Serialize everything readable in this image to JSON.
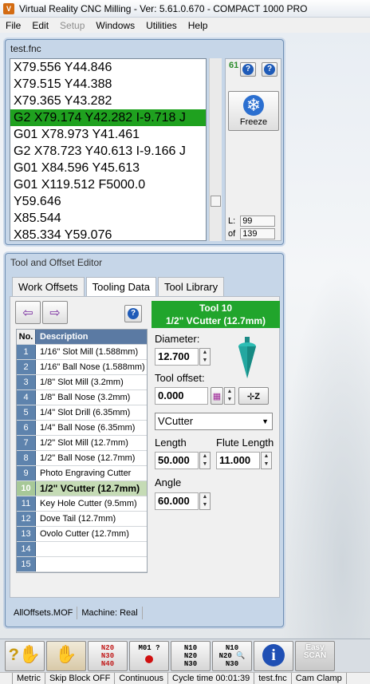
{
  "title_bar": {
    "title": "Virtual Reality CNC Milling  -  Ver: 5.61.0.670  -  COMPACT 1000 PRO"
  },
  "menu": {
    "items": [
      "File",
      "Edit",
      "Setup",
      "Windows",
      "Utilities",
      "Help"
    ]
  },
  "editor": {
    "title": "test.fnc",
    "lines": [
      "X79.556 Y44.846",
      "X79.515 Y44.388",
      "X79.365 Y43.282",
      "G2 X79.174 Y42.282 I-9.718 J",
      "G01 X78.973 Y41.461",
      "G2 X78.723 Y40.613 I-9.166 J",
      "G01 X84.596 Y45.613",
      "G01 X119.512 F5000.0",
      "Y59.646",
      "X85.544",
      "X85.334 Y59.076"
    ],
    "highlighted_line_index": 3,
    "gcode_indicator": "61",
    "freeze_label": "Freeze",
    "line_label": "L:",
    "line_value": "99",
    "of_label": "of",
    "of_value": "139"
  },
  "tool_editor": {
    "title": "Tool and Offset Editor",
    "tabs": [
      "Work Offsets",
      "Tooling Data",
      "Tool Library"
    ],
    "active_tab": "Tooling Data",
    "header": {
      "tool_number": "Tool 10",
      "tool_name": "1/2\" VCutter (12.7mm)"
    },
    "table": {
      "columns": [
        "No.",
        "Description"
      ],
      "rows": [
        {
          "no": "1",
          "desc": "1/16\" Slot Mill (1.588mm)"
        },
        {
          "no": "2",
          "desc": "1/16\" Ball Nose (1.588mm)"
        },
        {
          "no": "3",
          "desc": "1/8\" Slot Mill (3.2mm)"
        },
        {
          "no": "4",
          "desc": "1/8\" Ball Nose (3.2mm)"
        },
        {
          "no": "5",
          "desc": "1/4\" Slot Drill (6.35mm)"
        },
        {
          "no": "6",
          "desc": "1/4\" Ball Nose (6.35mm)"
        },
        {
          "no": "7",
          "desc": "1/2\" Slot Mill (12.7mm)"
        },
        {
          "no": "8",
          "desc": "1/2\" Ball Nose (12.7mm)"
        },
        {
          "no": "9",
          "desc": "Photo Engraving Cutter"
        },
        {
          "no": "10",
          "desc": "1/2\" VCutter (12.7mm)"
        },
        {
          "no": "11",
          "desc": "Key Hole Cutter (9.5mm)"
        },
        {
          "no": "12",
          "desc": "Dove Tail (12.7mm)"
        },
        {
          "no": "13",
          "desc": "Ovolo Cutter (12.7mm)"
        },
        {
          "no": "14",
          "desc": ""
        },
        {
          "no": "15",
          "desc": ""
        }
      ],
      "selected_row_index": 9
    },
    "fields": {
      "diameter_label": "Diameter:",
      "diameter_value": "12.700",
      "tool_offset_label": "Tool offset:",
      "tool_offset_value": "0.000",
      "cutter_type": "VCutter",
      "length_label": "Length",
      "length_value": "50.000",
      "flute_length_label": "Flute Length",
      "flute_length_value": "11.000",
      "angle_label": "Angle",
      "angle_value": "60.000"
    },
    "status": {
      "file": "AllOffsets.MOF",
      "machine": "Machine: Real"
    }
  },
  "bottom_toolbar": {
    "buttons": [
      "help-button",
      "hand-button",
      "gcode-n20-button",
      "m01-button",
      "n10-button",
      "n10-search-button",
      "info-button",
      "easy-scan-button"
    ],
    "m01_label": "M01 ?",
    "easy_scan_label": "Easy SCAN"
  },
  "status_bar": {
    "units": "Metric",
    "skip_block": "Skip Block OFF",
    "mode": "Continuous",
    "cycle_time": "Cycle time 00:01:39",
    "file": "test.fnc",
    "cam_clamp": "Cam Clamp"
  }
}
